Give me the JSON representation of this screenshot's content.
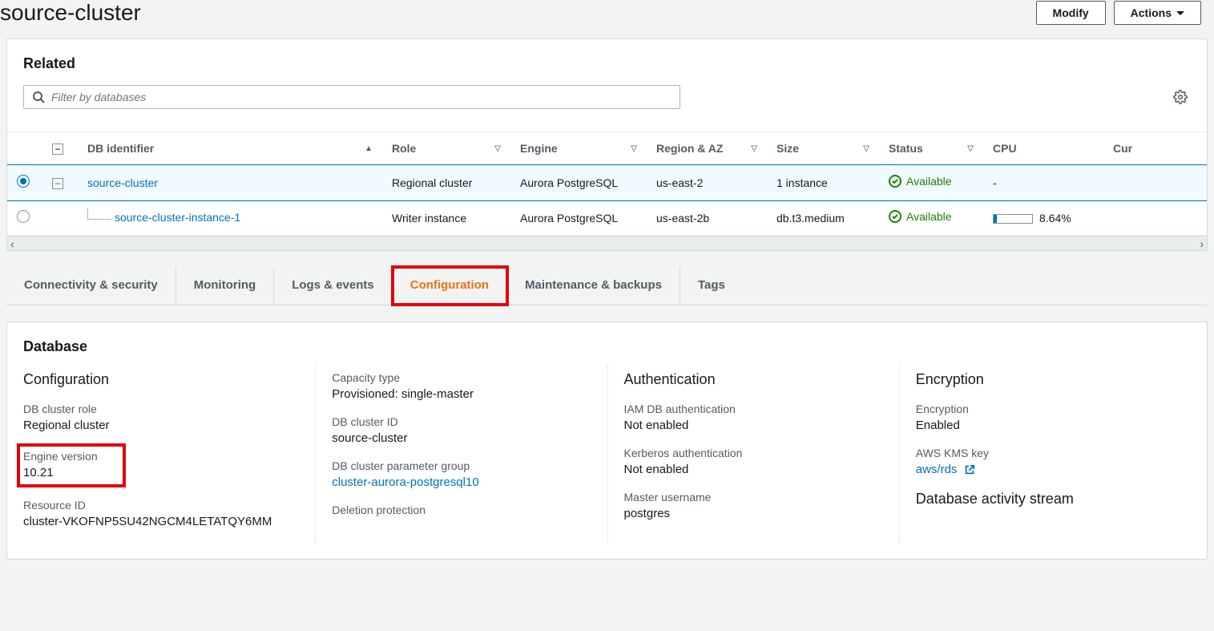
{
  "header": {
    "title": "source-cluster",
    "modify_label": "Modify",
    "actions_label": "Actions"
  },
  "related": {
    "title": "Related",
    "filter_placeholder": "Filter by databases",
    "columns": {
      "db_identifier": "DB identifier",
      "role": "Role",
      "engine": "Engine",
      "region_az": "Region & AZ",
      "size": "Size",
      "status": "Status",
      "cpu": "CPU",
      "cur": "Cur"
    },
    "rows": [
      {
        "selected": true,
        "db_identifier": "source-cluster",
        "role": "Regional cluster",
        "engine": "Aurora PostgreSQL",
        "region_az": "us-east-2",
        "size": "1 instance",
        "status": "Available",
        "cpu": "-",
        "indent": 0
      },
      {
        "selected": false,
        "db_identifier": "source-cluster-instance-1",
        "role": "Writer instance",
        "engine": "Aurora PostgreSQL",
        "region_az": "us-east-2b",
        "size": "db.t3.medium",
        "status": "Available",
        "cpu": "8.64%",
        "indent": 1
      }
    ]
  },
  "tabs": [
    {
      "label": "Connectivity & security",
      "active": false
    },
    {
      "label": "Monitoring",
      "active": false
    },
    {
      "label": "Logs & events",
      "active": false
    },
    {
      "label": "Configuration",
      "active": true
    },
    {
      "label": "Maintenance & backups",
      "active": false
    },
    {
      "label": "Tags",
      "active": false
    }
  ],
  "database": {
    "panel_title": "Database",
    "configuration": {
      "heading": "Configuration",
      "db_cluster_role_label": "DB cluster role",
      "db_cluster_role_value": "Regional cluster",
      "engine_version_label": "Engine version",
      "engine_version_value": "10.21",
      "resource_id_label": "Resource ID",
      "resource_id_value": "cluster-VKOFNP5SU42NGCM4LETATQY6MM"
    },
    "capacity": {
      "capacity_type_label": "Capacity type",
      "capacity_type_value": "Provisioned: single-master",
      "db_cluster_id_label": "DB cluster ID",
      "db_cluster_id_value": "source-cluster",
      "param_group_label": "DB cluster parameter group",
      "param_group_value": "cluster-aurora-postgresql10",
      "deletion_protection_label": "Deletion protection"
    },
    "authentication": {
      "heading": "Authentication",
      "iam_label": "IAM DB authentication",
      "iam_value": "Not enabled",
      "kerberos_label": "Kerberos authentication",
      "kerberos_value": "Not enabled",
      "master_user_label": "Master username",
      "master_user_value": "postgres"
    },
    "encryption": {
      "heading": "Encryption",
      "encryption_label": "Encryption",
      "encryption_value": "Enabled",
      "kms_label": "AWS KMS key",
      "kms_value": "aws/rds",
      "activity_heading": "Database activity stream"
    }
  }
}
